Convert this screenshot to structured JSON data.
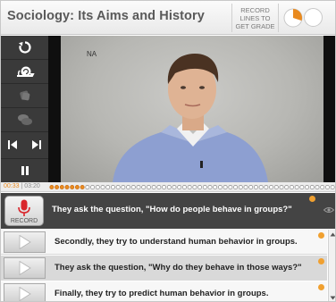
{
  "header": {
    "title": "Sociology: Its Aims and History",
    "grade_text": "RECORD LINES TO GET GRADE",
    "progress_fraction": 0.3
  },
  "sidebar": {
    "icons": [
      "replay-icon",
      "slow-snail-icon",
      "hint-icon",
      "chat-bubbles-icon",
      "previous-icon",
      "next-icon",
      "pause-icon"
    ]
  },
  "video": {
    "overlay_text": "NA"
  },
  "timeline": {
    "current": "00:33",
    "separator": " | ",
    "total": "03:20",
    "segments_total": 56,
    "segments_done": 7
  },
  "current_line": {
    "record_label": "RECORD",
    "text": "They ask the question, \"How do people behave in groups?\""
  },
  "lines": [
    {
      "text": "Secondly, they try to understand human behavior in groups."
    },
    {
      "text": "They ask the question, \"Why do they behave in those ways?\""
    },
    {
      "text": "Finally, they try to predict human behavior in groups."
    }
  ],
  "colors": {
    "accent": "#e98a1f",
    "record": "#d9262c",
    "panel": "#444444"
  }
}
